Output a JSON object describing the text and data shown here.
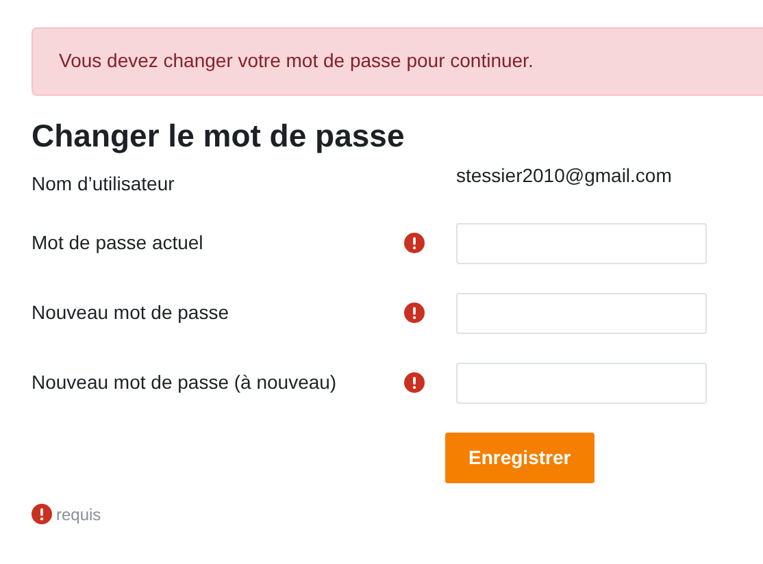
{
  "alert": {
    "message": "Vous devez changer votre mot de passe pour continuer."
  },
  "heading": "Changer le mot de passe",
  "fields": [
    {
      "kind": "static",
      "label": "Nom d’utilisateur",
      "value": "stessier2010@gmail.com",
      "required": false
    },
    {
      "kind": "password",
      "label": "Mot de passe actuel",
      "required": true
    },
    {
      "kind": "password",
      "label": "Nouveau mot de passe",
      "required": true
    },
    {
      "kind": "password",
      "label": "Nouveau mot de passe (à nouveau)",
      "required": true
    }
  ],
  "submit_button": "Enregistrer",
  "legend": {
    "text": "requis"
  }
}
